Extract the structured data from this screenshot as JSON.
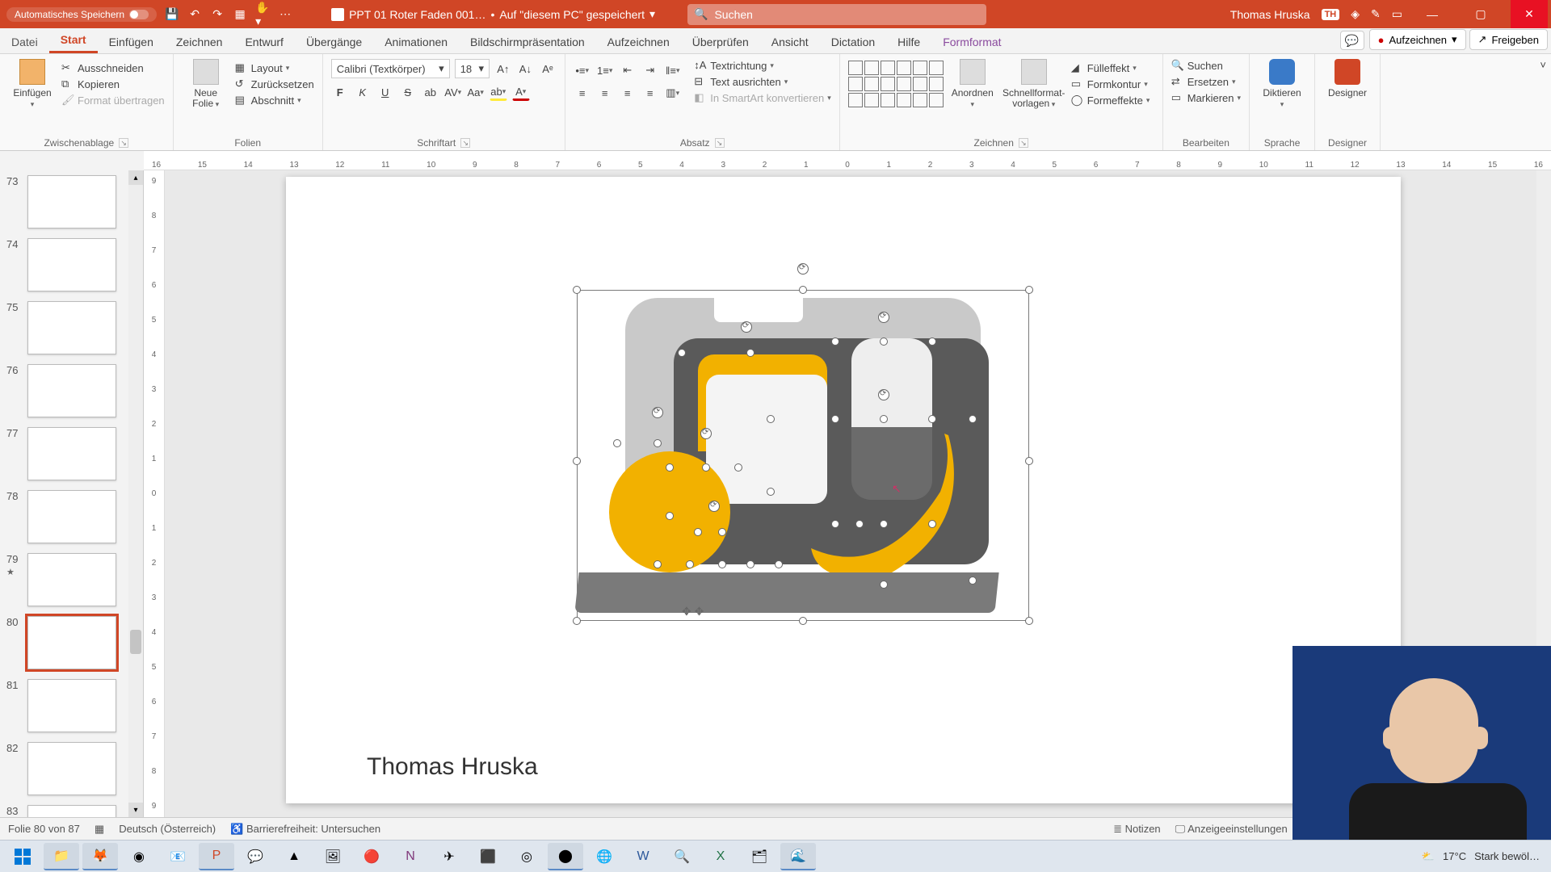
{
  "colors": {
    "accent": "#d04626",
    "contextual": "#8a4a9e"
  },
  "titlebar": {
    "autosave_label": "Automatisches Speichern",
    "doc_name": "PPT 01 Roter Faden 001…",
    "doc_status": "Auf \"diesem PC\" gespeichert",
    "search_placeholder": "Suchen",
    "user_name": "Thomas Hruska",
    "user_initials": "TH"
  },
  "tabs": {
    "file": "Datei",
    "items": [
      "Start",
      "Einfügen",
      "Zeichnen",
      "Entwurf",
      "Übergänge",
      "Animationen",
      "Bildschirmpräsentation",
      "Aufzeichnen",
      "Überprüfen",
      "Ansicht",
      "Dictation",
      "Hilfe"
    ],
    "active": "Start",
    "contextual": "Formformat",
    "record_btn": "Aufzeichnen",
    "share_btn": "Freigeben"
  },
  "ribbon": {
    "clipboard": {
      "paste": "Einfügen",
      "cut": "Ausschneiden",
      "copy": "Kopieren",
      "format_painter": "Format übertragen",
      "label": "Zwischenablage"
    },
    "slides": {
      "new_slide": "Neue Folie",
      "layout": "Layout",
      "reset": "Zurücksetzen",
      "section": "Abschnitt",
      "label": "Folien"
    },
    "font": {
      "family": "Calibri (Textkörper)",
      "size": "18",
      "label": "Schriftart"
    },
    "paragraph": {
      "text_direction": "Textrichtung",
      "align_text": "Text ausrichten",
      "smartart": "In SmartArt konvertieren",
      "label": "Absatz"
    },
    "drawing": {
      "arrange": "Anordnen",
      "quick_styles": "Schnellformat-vorlagen",
      "fill": "Fülleffekt",
      "outline": "Formkontur",
      "effects": "Formeffekte",
      "label": "Zeichnen"
    },
    "editing": {
      "find": "Suchen",
      "replace": "Ersetzen",
      "select": "Markieren",
      "label": "Bearbeiten"
    },
    "voice": {
      "dictate": "Diktieren",
      "label": "Sprache"
    },
    "designer": {
      "btn": "Designer",
      "label": "Designer"
    }
  },
  "ruler_h": [
    "16",
    "15",
    "14",
    "13",
    "12",
    "11",
    "10",
    "9",
    "8",
    "7",
    "6",
    "5",
    "4",
    "3",
    "2",
    "1",
    "0",
    "1",
    "2",
    "3",
    "4",
    "5",
    "6",
    "7",
    "8",
    "9",
    "10",
    "11",
    "12",
    "13",
    "14",
    "15",
    "16"
  ],
  "ruler_v": [
    "9",
    "8",
    "7",
    "6",
    "5",
    "4",
    "3",
    "2",
    "1",
    "0",
    "1",
    "2",
    "3",
    "4",
    "5",
    "6",
    "7",
    "8",
    "9"
  ],
  "thumbnails": [
    {
      "n": "73",
      "sel": false,
      "star": false
    },
    {
      "n": "74",
      "sel": false,
      "star": false
    },
    {
      "n": "75",
      "sel": false,
      "star": false
    },
    {
      "n": "76",
      "sel": false,
      "star": false
    },
    {
      "n": "77",
      "sel": false,
      "star": false
    },
    {
      "n": "78",
      "sel": false,
      "star": false
    },
    {
      "n": "79",
      "sel": false,
      "star": true
    },
    {
      "n": "80",
      "sel": true,
      "star": false
    },
    {
      "n": "81",
      "sel": false,
      "star": false
    },
    {
      "n": "82",
      "sel": false,
      "star": false
    },
    {
      "n": "83",
      "sel": false,
      "star": false
    }
  ],
  "slide": {
    "author": "Thomas Hruska"
  },
  "status": {
    "slide_of": "Folie 80 von 87",
    "language": "Deutsch (Österreich)",
    "accessibility": "Barrierefreiheit: Untersuchen",
    "notes": "Notizen",
    "display_settings": "Anzeigeeinstellungen"
  },
  "taskbar": {
    "weather_temp": "17°C",
    "weather_text": "Stark bewöl…"
  }
}
